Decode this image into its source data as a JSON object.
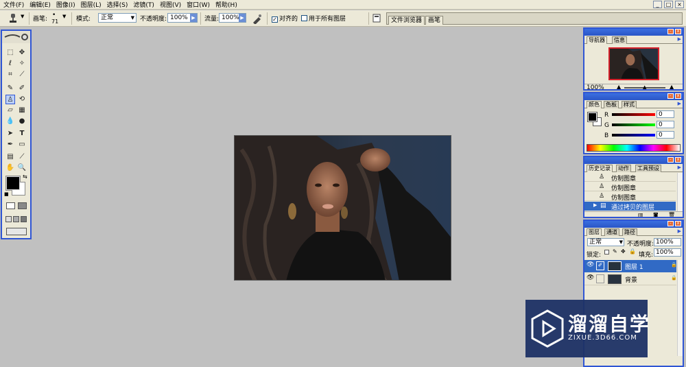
{
  "menubar": {
    "items": [
      "文件(F)",
      "编辑(E)",
      "图像(I)",
      "图层(L)",
      "选择(S)",
      "滤镜(T)",
      "视图(V)",
      "窗口(W)",
      "帮助(H)"
    ],
    "win_min": "_",
    "win_max": "□",
    "win_close": "×"
  },
  "options": {
    "brush_label": "画笔:",
    "brush_size": "71",
    "mode_label": "模式:",
    "mode_value": "正常",
    "opacity_label": "不透明度:",
    "opacity_value": "100%",
    "flow_label": "流量:",
    "flow_value": "100%",
    "aligned_label": "对齐的",
    "aligned_checked": "✓",
    "all_layers_label": "用于所有图层",
    "well_tabs": [
      "文件浏览器",
      "画笔"
    ]
  },
  "navigator": {
    "tabs": [
      "导航器",
      "信息"
    ],
    "zoom": "100%"
  },
  "color": {
    "tabs": [
      "颜色",
      "色板",
      "样式"
    ],
    "r_label": "R",
    "g_label": "G",
    "b_label": "B",
    "r_value": "0",
    "g_value": "0",
    "b_value": "0"
  },
  "history": {
    "tabs": [
      "历史记录",
      "动作",
      "工具预设"
    ],
    "items": [
      "仿制图章",
      "仿制图章",
      "仿制图章",
      "通过拷贝的图层"
    ]
  },
  "layers": {
    "tabs": [
      "图层",
      "通道",
      "路径"
    ],
    "blend_mode": "正常",
    "opacity_label": "不透明度:",
    "opacity_value": "100%",
    "lock_label": "锁定:",
    "fill_label": "填充:",
    "fill_value": "100%",
    "items": [
      "图层 1",
      "背景"
    ]
  },
  "watermark": {
    "brand": "溜溜自学",
    "url": "ZIXUE.3D66.COM"
  },
  "colors": {
    "panel_border": "#2f55d4",
    "selected_row": "#316ac5",
    "workspace": "#c0c0c0"
  }
}
